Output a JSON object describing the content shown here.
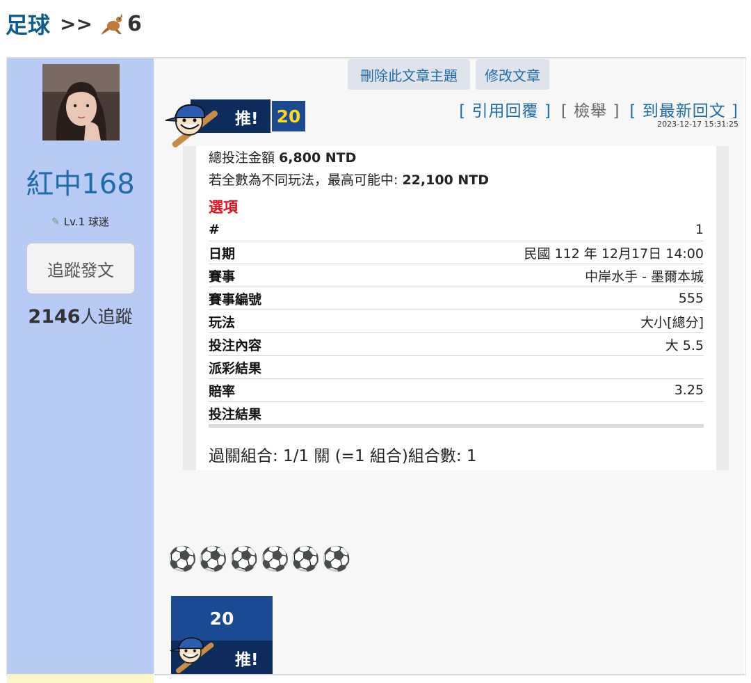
{
  "breadcrumb": {
    "root": "足球",
    "separator": ">>",
    "page_suffix": "6",
    "page_icon": "kangaroo-icon"
  },
  "user": {
    "name": "紅中168",
    "level": "Lv.1 球迷",
    "follow_button": "追蹤發文",
    "followers_count": "2146",
    "followers_label": "人追蹤"
  },
  "admin": {
    "delete_topic": "刪除此文章主題",
    "edit_post": "修改文章"
  },
  "push": {
    "label": "推!",
    "count": "20"
  },
  "actions": {
    "quote_reply": "[ 引用回覆 ]",
    "report": "[ 檢舉 ]",
    "latest_reply": "[ 到最新回文 ]",
    "timestamp": "2023-12-17 15:31:25"
  },
  "bet": {
    "total_label": "總投注金額",
    "total_value": "6,800 NTD",
    "max_label": "若全數為不同玩法，最高可能中:",
    "max_value": "22,100 NTD",
    "options_title": "選項",
    "rows": [
      {
        "k": "#",
        "v": "1"
      },
      {
        "k": "日期",
        "v": "民國 112 年 12月17日 14:00"
      },
      {
        "k": "賽事",
        "v": "中岸水手 - 墨爾本城"
      },
      {
        "k": "賽事編號",
        "v": "555"
      },
      {
        "k": "玩法",
        "v": "大小[總分]"
      },
      {
        "k": "投注內容",
        "v": "大 5.5"
      },
      {
        "k": "派彩結果",
        "v": ""
      },
      {
        "k": "賠率",
        "v": "3.25"
      },
      {
        "k": "投注結果",
        "v": ""
      }
    ],
    "combo_text": "過關組合: 1/1 關 (=1 組合)組合數: 1"
  },
  "post_body": {
    "balls": "⚽⚽⚽⚽⚽⚽"
  },
  "colors": {
    "sidebar": "#b7cbf4",
    "link": "#1f6ca6",
    "badge_dark": "#0c2d5c",
    "badge_blue": "#1b4a92",
    "count_yellow": "#ffd91b",
    "options_red": "#e0141c"
  }
}
